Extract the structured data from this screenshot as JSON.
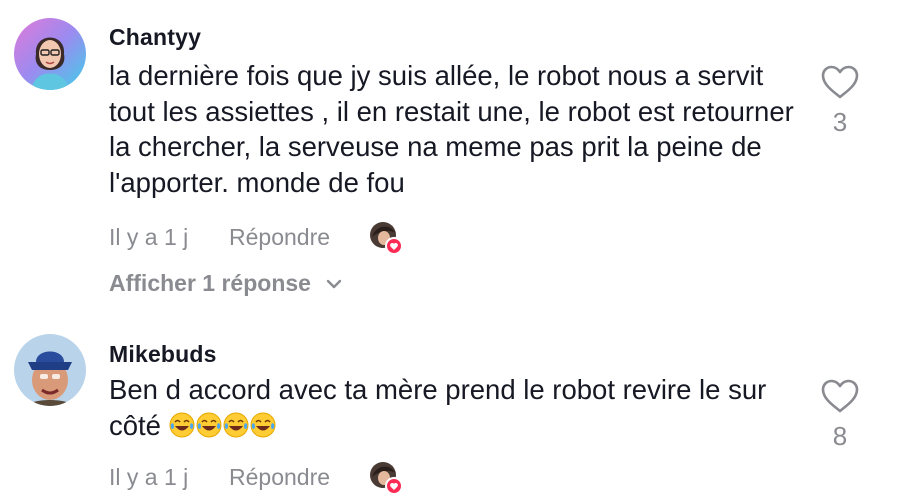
{
  "comments": [
    {
      "username": "Chantyy",
      "text": "la dernière fois que jy suis allée, le robot nous a servit tout les assiettes , il en restait une, le robot est retourner la chercher, la serveuse na meme pas prit la peine de l'apporter. monde de fou",
      "time": "Il y a 1 j",
      "reply_label": "Répondre",
      "like_count": "3",
      "view_replies_label": "Afficher 1 réponse"
    },
    {
      "username": "Mikebuds",
      "text": "Ben d accord avec ta mère prend le robot revire le sur côté",
      "emoji": "😂😂😂😂",
      "time": "Il y a 1 j",
      "reply_label": "Répondre",
      "like_count": "8"
    }
  ],
  "icons": {
    "like": "heart-outline-icon",
    "expand": "chevron-down-icon",
    "creator_liked": "creator-liked-badge-icon"
  },
  "colors": {
    "text": "#161823",
    "muted": "#8a8b91",
    "like_badge": "#fe2c55"
  }
}
